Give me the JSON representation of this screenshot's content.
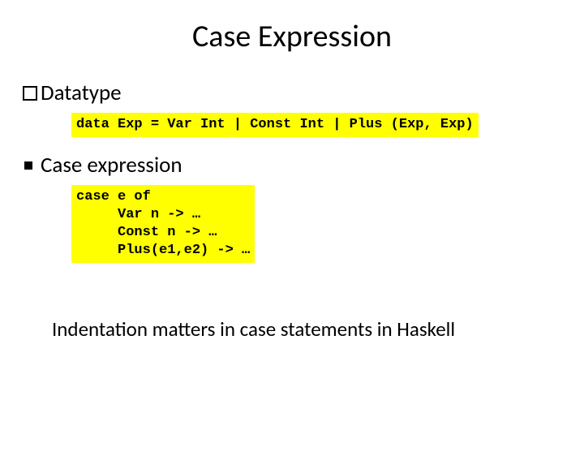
{
  "title": "Case Expression",
  "bullets": {
    "datatype": "Datatype",
    "caseexpr": "Case expression"
  },
  "code": {
    "datatype": "data Exp = Var Int | Const Int | Plus (Exp, Exp)",
    "caseblock": "case e of\n     Var n -> …\n     Const n -> …\n     Plus(e1,e2) -> …"
  },
  "footer": "Indentation matters in case statements in Haskell"
}
